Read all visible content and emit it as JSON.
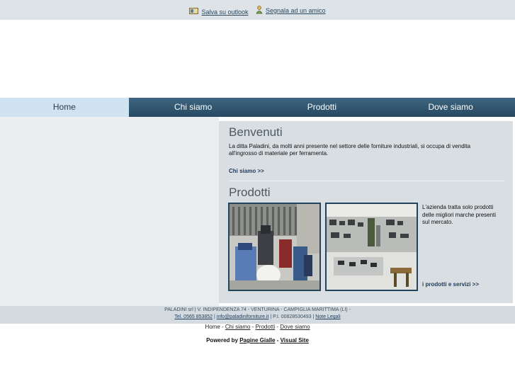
{
  "topbar": {
    "save_outlook": "Salva su outlook",
    "tell_friend": "Segnala ad un amico"
  },
  "nav": [
    "Home",
    "Chi siamo",
    "Prodotti",
    "Dove siamo"
  ],
  "welcome": {
    "title": "Benvenuti",
    "text_line1": "La ditta Paladini, da molti anni presente nel settore delle forniture industriali, si occupa di vendita",
    "text_line2": "all'ingrosso di materiale per ferramenta.",
    "more": "Chi siamo >>"
  },
  "products": {
    "title": "Prodotti",
    "desc_line1": "L'azienda tratta solo prodotti",
    "desc_line2": "delle migliori marche presenti",
    "desc_line3": "sul mercato.",
    "more": "i prodotti e servizi >>"
  },
  "footer": {
    "address": "PALADINI srl | V. INDIPENDENZA 74 - VENTURINA - CAMPIGLIA MARITTIMA (LI) -",
    "phone": "Tel. 0565 853852",
    "sep1": " | ",
    "email": "info@paladiniforniture.it",
    "vat": " | P.I. 00828530493 | ",
    "legal": "Note Legali"
  },
  "bottomnav": {
    "home": "Home",
    "chi": "Chi siamo",
    "prodotti": "Prodotti",
    "dove": "Dove siamo",
    "sep": " - "
  },
  "powered": {
    "label": "Powered by ",
    "pg": "Pagine Gialle",
    "dash": " - ",
    "vs": "Visual Site"
  }
}
